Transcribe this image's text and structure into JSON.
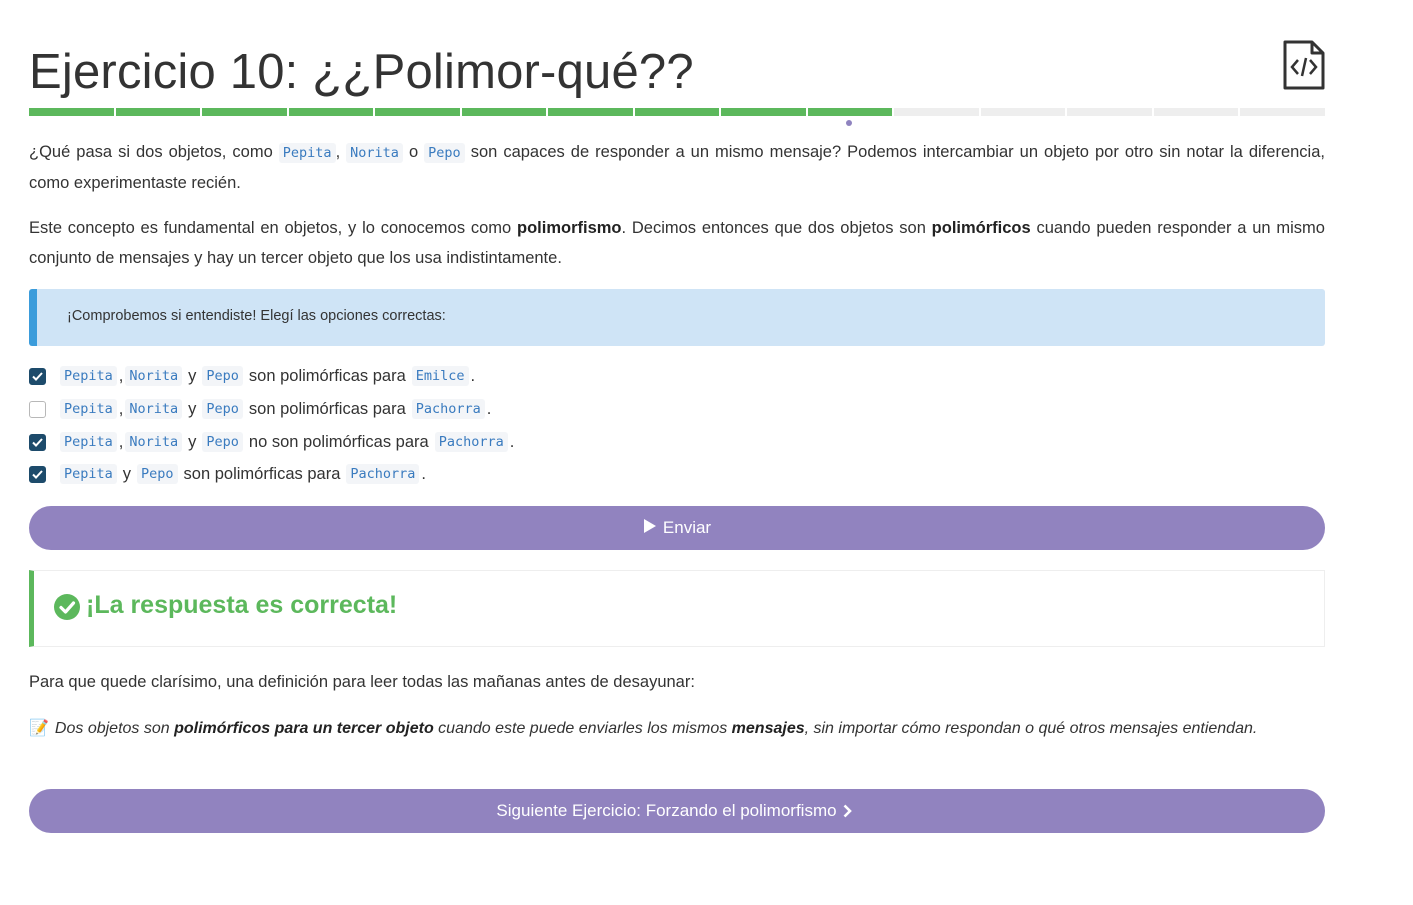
{
  "header": {
    "title": "Ejercicio 10: ¿¿Polimor-qué??",
    "code_icon": "code-file-icon"
  },
  "progress": {
    "total": 15,
    "completed": 10,
    "current": 10
  },
  "intro": {
    "p1_a": "¿Qué pasa si dos objetos, como",
    "p1_code1": "Pepita",
    "p1_sep": ",",
    "p1_code2": "Norita",
    "p1_o": "o",
    "p1_code3": "Pepo",
    "p1_b": "son capaces de responder a un mismo mensaje? Podemos intercambiar un objeto por otro sin notar la diferencia, como experimentaste recién.",
    "p2_a": "Este concepto es fundamental en objetos, y lo conocemos como",
    "p2_bold1": "polimorfismo",
    "p2_b": ". Decimos entonces que dos objetos son",
    "p2_bold2": "polimórficos",
    "p2_c": "cuando pueden responder a un mismo conjunto de mensajes y hay un tercer objeto que los usa indistintamente."
  },
  "info_box": {
    "text": "¡Comprobemos si entendiste! Elegí las opciones correctas:"
  },
  "options": [
    {
      "checked": true,
      "c1": "Pepita",
      "c2": "Norita",
      "c3": "Pepo",
      "y": "y",
      "text": "son polimórficas para",
      "target": "Emilce"
    },
    {
      "checked": false,
      "c1": "Pepita",
      "c2": "Norita",
      "c3": "Pepo",
      "y": "y",
      "text": "son polimórficas para",
      "target": "Pachorra"
    },
    {
      "checked": true,
      "c1": "Pepita",
      "c2": "Norita",
      "c3": "Pepo",
      "y": "y",
      "text": "no son polimórficas para",
      "target": "Pachorra"
    },
    {
      "checked": true,
      "c1": "Pepita",
      "c3": "Pepo",
      "y": "y",
      "text": "son polimórficas para",
      "target": "Pachorra"
    }
  ],
  "submit": {
    "label": "Enviar",
    "icon": "play-icon"
  },
  "result": {
    "text": "¡La respuesta es correcta!",
    "icon": "check-circle-icon"
  },
  "outro": {
    "text": "Para que quede clarísimo, una definición para leer todas las mañanas antes de desayunar:",
    "memo_icon": "📝",
    "memo_a": "Dos objetos son",
    "memo_bold1": "polimórficos para un tercer objeto",
    "memo_b": "cuando este puede enviarles los mismos",
    "memo_bold2": "mensajes",
    "memo_c": ", sin importar cómo respondan o qué otros mensajes entiendan."
  },
  "next": {
    "label": "Siguiente Ejercicio: Forzando el polimorfismo",
    "icon": "chevron-right-icon"
  },
  "colors": {
    "accent": "#9183bf",
    "success": "#5cb85c",
    "info_bg": "#cfe4f6",
    "info_border": "#3b9cdb",
    "checkbox": "#1d4b6b",
    "code": "#3a7bbf"
  }
}
